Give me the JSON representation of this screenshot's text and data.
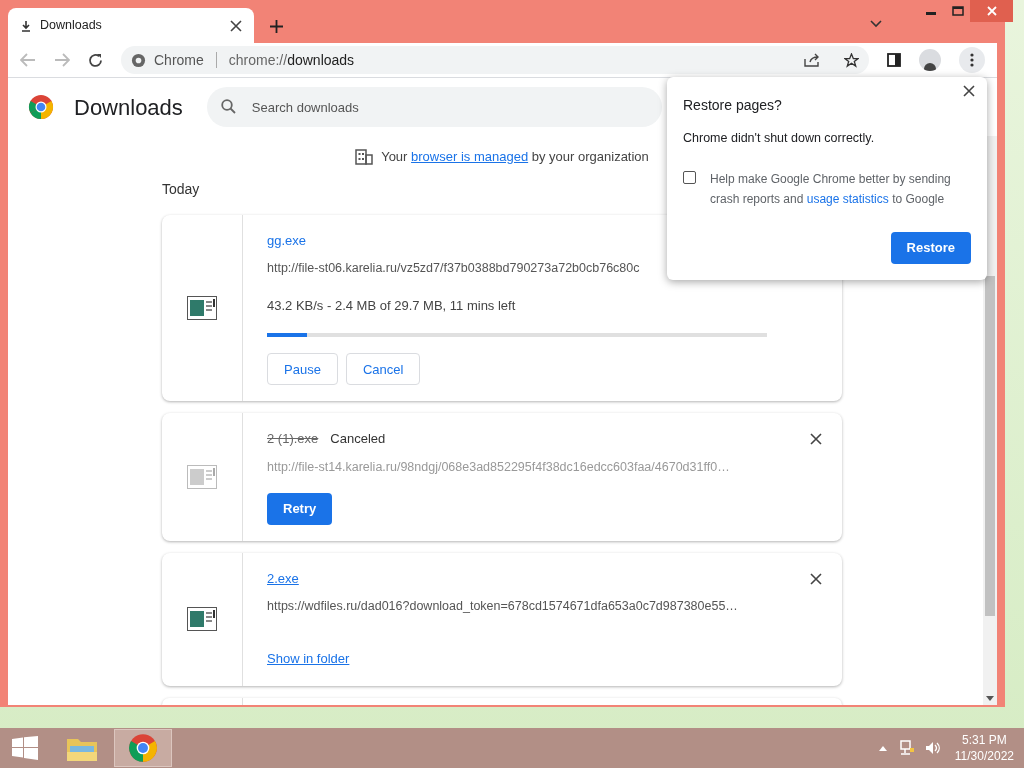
{
  "tab": {
    "title": "Downloads",
    "selected": true
  },
  "omnibox": {
    "site": "Chrome",
    "url_prefix": "chrome://",
    "url_host": "downloads"
  },
  "page": {
    "title": "Downloads",
    "search": {
      "placeholder": "Search downloads"
    }
  },
  "managed_notice": {
    "before": "Your",
    "link": "browser is managed",
    "after": "by your organization"
  },
  "section": "Today",
  "downloads": [
    {
      "kind": "in_progress",
      "name": "gg.exe",
      "url": "http://file-st06.karelia.ru/vz5zd7/f37b0388bd790273a72b0cb76c80c",
      "progress_text": "43.2 KB/s - 2.4 MB of 29.7 MB, 11 mins left",
      "level": 0.08,
      "buttons": [
        "Pause",
        "Cancel"
      ]
    },
    {
      "kind": "canceled",
      "name": "2 (1).exe",
      "status": "Canceled",
      "url": "http://file-st14.karelia.ru/98ndgj/068e3ad852295f4f38dc16edcc603faa/4670d31ff0…",
      "buttons": [
        "Retry"
      ]
    },
    {
      "kind": "complete",
      "name": "2.exe",
      "url": "https://wdfiles.ru/dad016?download_token=678cd1574671dfa653a0c7d987380e55…",
      "link": "Show in folder"
    }
  ],
  "popup": {
    "title": "Restore pages?",
    "message": "Chrome didn't shut down correctly.",
    "checkbox": {
      "checked": false,
      "before": "Help make Google Chrome better by sending crash reports and",
      "link": "usage statistics",
      "after": "to Google"
    },
    "button": "Restore"
  },
  "taskbar": {
    "time": "5:31 PM",
    "date": "11/30/2022"
  }
}
